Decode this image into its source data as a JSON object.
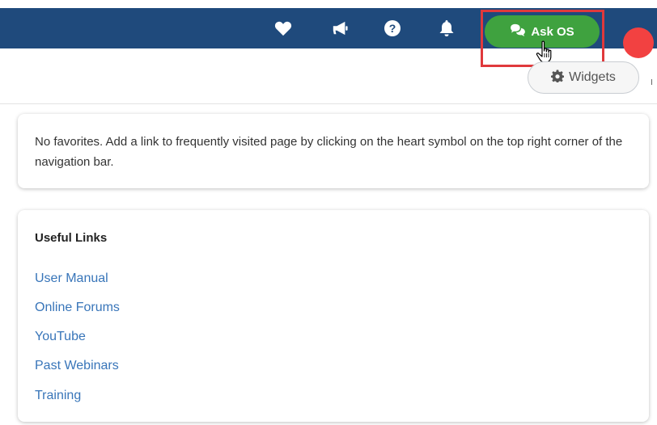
{
  "navbar": {
    "ask_label": "Ask OS",
    "icons": [
      "heart-icon",
      "megaphone-icon",
      "help-icon",
      "bell-icon",
      "chat-icon"
    ]
  },
  "toolbar": {
    "widgets_label": "Widgets"
  },
  "favorites": {
    "empty_message": "No favorites. Add a link to frequently visited page by clicking on the heart symbol on the top right corner of the navigation bar."
  },
  "useful_links": {
    "title": "Useful Links",
    "items": [
      {
        "label": "User Manual"
      },
      {
        "label": "Online Forums"
      },
      {
        "label": "YouTube"
      },
      {
        "label": "Past Webinars"
      },
      {
        "label": "Training"
      }
    ]
  },
  "colors": {
    "navbar": "#1f4a7c",
    "ask_button": "#3fa23f",
    "link": "#3875b9",
    "highlight": "#e0393c",
    "avatar": "#f24141"
  }
}
